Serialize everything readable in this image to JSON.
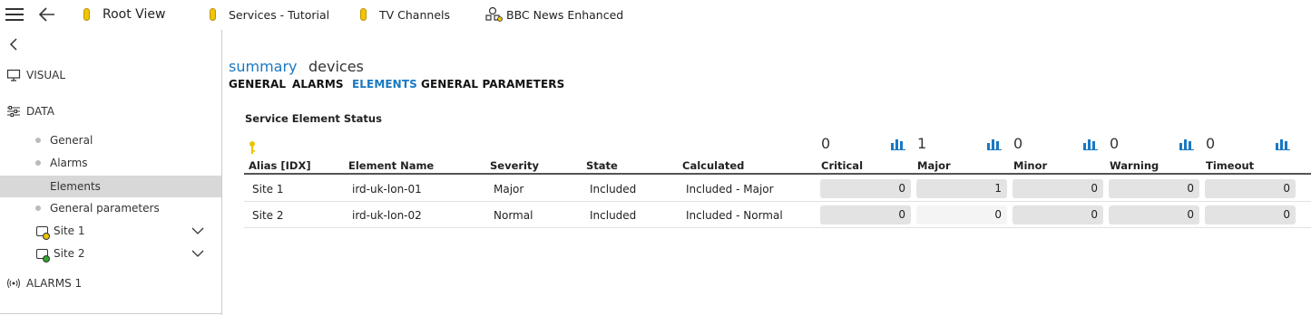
{
  "breadcrumbs": [
    {
      "label": "Root View"
    },
    {
      "label": "Services - Tutorial"
    },
    {
      "label": "TV Channels"
    },
    {
      "label": "BBC News Enhanced"
    }
  ],
  "sidebar": {
    "visual_label": "VISUAL",
    "data_label": "DATA",
    "items": [
      {
        "label": "General"
      },
      {
        "label": "Alarms"
      },
      {
        "label": "Elements"
      },
      {
        "label": "General parameters"
      }
    ],
    "sites": [
      {
        "label": "Site 1",
        "led_color": "#e8c400"
      },
      {
        "label": "Site 2",
        "led_color": "#2ea82e"
      }
    ],
    "alarms_label": "ALARMS 1"
  },
  "main": {
    "view_tabs": [
      {
        "label": "summary"
      },
      {
        "label": "devices"
      }
    ],
    "sub_tabs": [
      {
        "label": "GENERAL"
      },
      {
        "label": "ALARMS"
      },
      {
        "label": "ELEMENTS"
      },
      {
        "label": "GENERAL PARAMETERS"
      }
    ],
    "section_title": "Service Element Status",
    "summary_counts": {
      "critical": "0",
      "major": "1",
      "minor": "0",
      "warning": "0",
      "timeout": "0"
    },
    "columns": [
      "Alias [IDX]",
      "Element Name",
      "Severity",
      "State",
      "Calculated",
      "Critical",
      "Major",
      "Minor",
      "Warning",
      "Timeout"
    ],
    "rows": [
      {
        "alias": "Site 1",
        "element": "ird-uk-lon-01",
        "severity": "Major",
        "state": "Included",
        "calculated": "Included - Major",
        "critical": "0",
        "major": "1",
        "minor": "0",
        "warning": "0",
        "timeout": "0"
      },
      {
        "alias": "Site 2",
        "element": "ird-uk-lon-02",
        "severity": "Normal",
        "state": "Included",
        "calculated": "Included - Normal",
        "critical": "0",
        "major": "0",
        "minor": "0",
        "warning": "0",
        "timeout": "0"
      }
    ]
  },
  "colors": {
    "accent": "#1a78c2",
    "pill": "#f2c500",
    "key": "#e8c400"
  }
}
